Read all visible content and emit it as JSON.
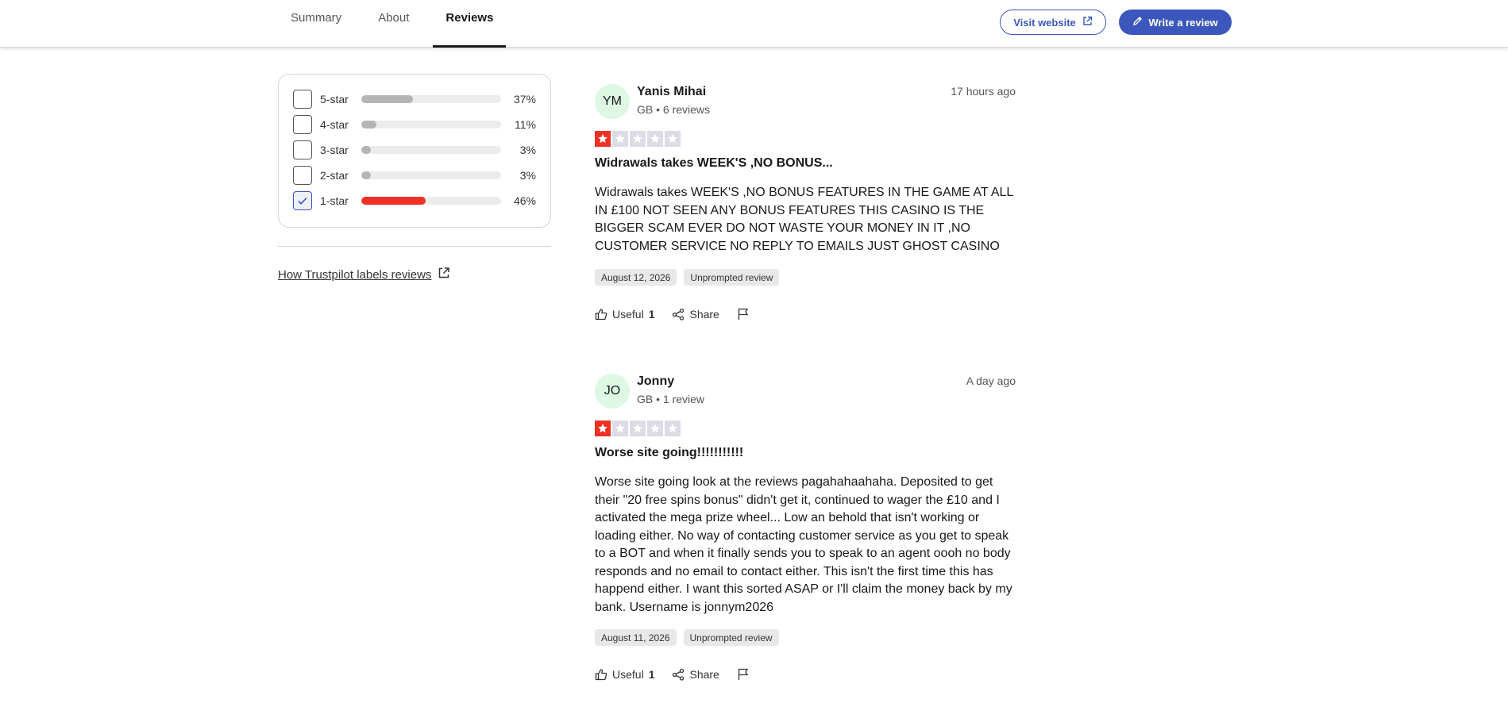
{
  "nav": {
    "tabs": [
      {
        "label": "Summary"
      },
      {
        "label": "About"
      },
      {
        "label": "Reviews"
      }
    ],
    "visit_label": "Visit website",
    "write_label": "Write a review"
  },
  "filters": {
    "rows": [
      {
        "label": "5-star",
        "pct": "37%",
        "value": 0.37,
        "checked": false
      },
      {
        "label": "4-star",
        "pct": "11%",
        "value": 0.11,
        "checked": false
      },
      {
        "label": "3-star",
        "pct": "3%",
        "value": 0.03,
        "checked": false
      },
      {
        "label": "2-star",
        "pct": "3%",
        "value": 0.03,
        "checked": false
      },
      {
        "label": "1-star",
        "pct": "46%",
        "value": 0.46,
        "checked": true
      }
    ],
    "labels_link": "How Trustpilot labels reviews"
  },
  "reviews": [
    {
      "initials": "YM",
      "name": "Yanis Mihai",
      "meta": "GB • 6 reviews",
      "time": "17 hours ago",
      "rating": 1,
      "title": "Widrawals takes WEEK'S ,NO BONUS...",
      "body": "Widrawals takes WEEK'S ,NO BONUS FEATURES IN THE GAME AT ALL IN £100 NOT SEEN ANY BONUS FEATURES THIS CASINO IS THE BIGGER SCAM EVER DO NOT WASTE YOUR MONEY IN IT ,NO CUSTOMER SERVICE NO REPLY TO EMAILS JUST GHOST CASINO",
      "date": "August 12, 2026",
      "tag": "Unprompted review",
      "useful_label": "Useful",
      "useful_count": "1",
      "share_label": "Share"
    },
    {
      "initials": "JO",
      "name": "Jonny",
      "meta": "GB • 1 review",
      "time": "A day ago",
      "rating": 1,
      "title": "Worse site going!!!!!!!!!!!",
      "body": "Worse site going look at the reviews pagahahaahaha. Deposited to get their \"20 free spins bonus\" didn't get it, continued to wager the £10 and I activated the mega prize wheel... Low an behold that isn't working or loading either. No way of contacting customer service as you get to speak to a BOT and when it finally sends you to speak to an agent oooh no body responds and no email to contact either. This isn't the first time this has happend either. I want this sorted ASAP or I'll claim the money back by my bank. Username is jonnym2026",
      "date": "August 11, 2026",
      "tag": "Unprompted review",
      "useful_label": "Useful",
      "useful_count": "1",
      "share_label": "Share"
    }
  ],
  "colors": {
    "accent": "#3c57bc",
    "one_star": "#ee3124",
    "avatar_bg": "#ddf8e4"
  }
}
